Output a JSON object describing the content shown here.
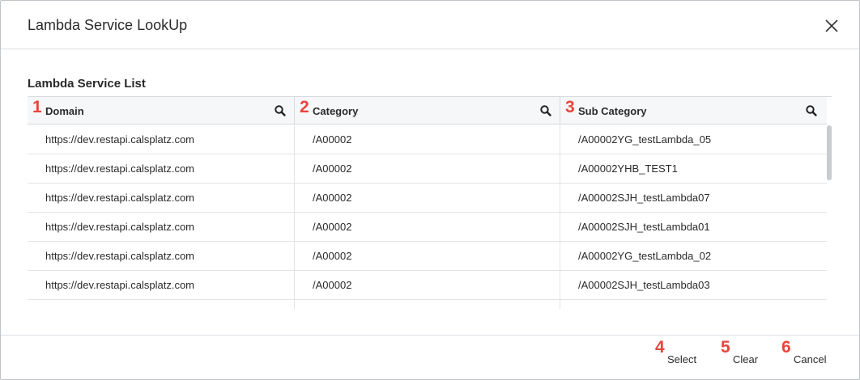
{
  "dialog": {
    "title": "Lambda Service LookUp",
    "close_icon": "close-icon"
  },
  "list": {
    "title": "Lambda Service List",
    "columns": [
      {
        "number": "1",
        "label": "Domain",
        "icon": "search-icon"
      },
      {
        "number": "2",
        "label": "Category",
        "icon": "search-icon"
      },
      {
        "number": "3",
        "label": "Sub Category",
        "icon": "search-icon"
      }
    ],
    "rows": [
      {
        "domain": "https://dev.restapi.calsplatz.com",
        "category": "/A00002",
        "sub_category": "/A00002YG_testLambda_05"
      },
      {
        "domain": "https://dev.restapi.calsplatz.com",
        "category": "/A00002",
        "sub_category": "/A00002YHB_TEST1"
      },
      {
        "domain": "https://dev.restapi.calsplatz.com",
        "category": "/A00002",
        "sub_category": "/A00002SJH_testLambda07"
      },
      {
        "domain": "https://dev.restapi.calsplatz.com",
        "category": "/A00002",
        "sub_category": "/A00002SJH_testLambda01"
      },
      {
        "domain": "https://dev.restapi.calsplatz.com",
        "category": "/A00002",
        "sub_category": "/A00002YG_testLambda_02"
      },
      {
        "domain": "https://dev.restapi.calsplatz.com",
        "category": "/A00002",
        "sub_category": "/A00002SJH_testLambda03"
      }
    ]
  },
  "footer": {
    "select": {
      "number": "4",
      "label": "Select"
    },
    "clear": {
      "number": "5",
      "label": "Clear"
    },
    "cancel": {
      "number": "6",
      "label": "Cancel"
    }
  },
  "colors": {
    "marker": "#e8453c",
    "border": "#d6d9dd",
    "header_bg": "#f6f7f8",
    "scroll_thumb": "#c9cccf"
  }
}
